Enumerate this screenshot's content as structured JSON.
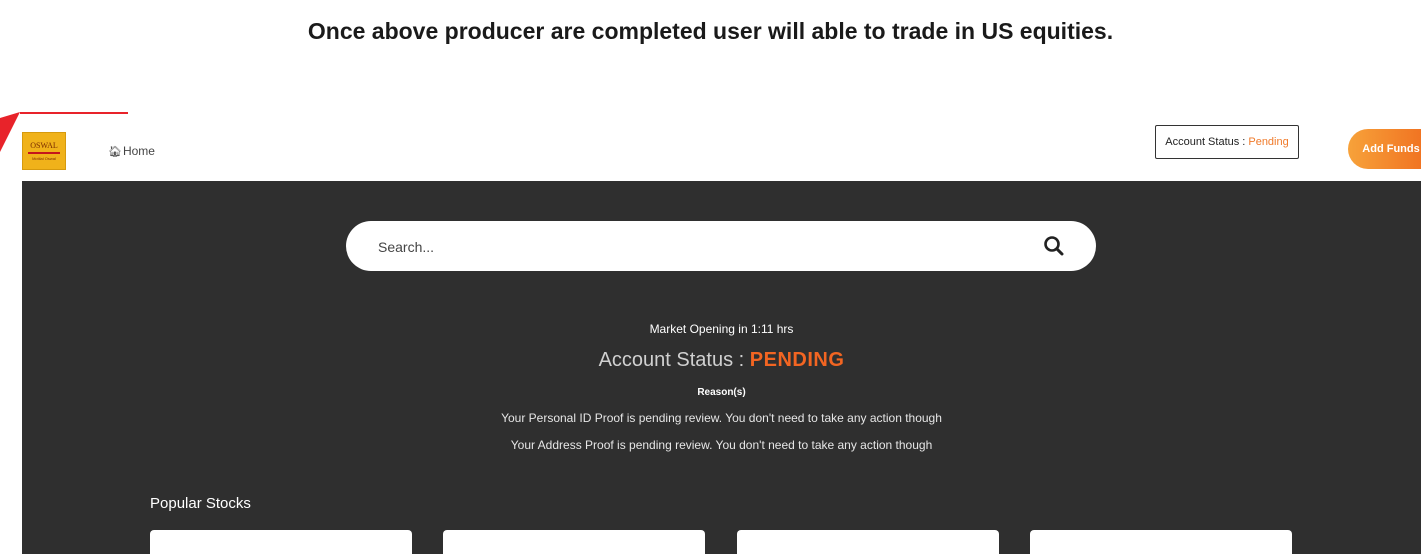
{
  "caption": "Once above producer are completed user will able to trade in US equities.",
  "colors": {
    "accent_orange": "#f26522",
    "pending_orange": "#f07a2a",
    "dark_background": "#2f2f2f",
    "corner_red": "#e8232a"
  },
  "header": {
    "logo": {
      "text": "OSWAL",
      "subtext": "Motilal Oswal",
      "icon": "brand-logo"
    },
    "home": {
      "icon": "home-icon",
      "label": "Home"
    },
    "account_status": {
      "label": "Account Status :",
      "value": "Pending"
    },
    "add_funds_label": "Add Funds"
  },
  "search": {
    "placeholder": "Search...",
    "icon": "search-icon"
  },
  "status": {
    "market_opening": "Market Opening in 1:11 hrs",
    "account_status_label": "Account Status :",
    "account_status_value": "PENDING",
    "reasons_heading": "Reason(s)",
    "reasons": [
      "Your Personal ID Proof is pending review. You don't need to take any action though",
      "Your Address Proof is pending review. You don't need to take any action though"
    ]
  },
  "popular_stocks": {
    "heading": "Popular Stocks",
    "cards": [
      {},
      {},
      {},
      {}
    ]
  }
}
